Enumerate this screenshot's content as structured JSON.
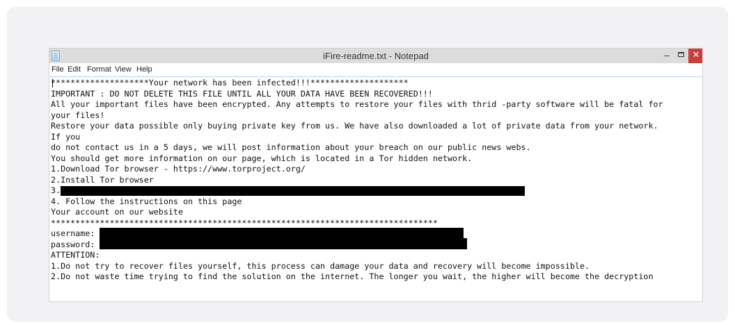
{
  "window": {
    "title": "iFire-readme.txt - Notepad",
    "minimize_glyph": "–",
    "close_glyph": "✕",
    "menu": [
      "File",
      "Edit",
      "Format",
      "View",
      "Help"
    ]
  },
  "document": {
    "lines": [
      "********************Your network has been infected!!!********************",
      "IMPORTANT : DO NOT DELETE THIS FILE UNTIL ALL YOUR DATA HAVE BEEN RECOVERED!!!",
      "All your important files have been encrypted. Any attempts to restore your files with thrid -party software will be fatal for",
      "your files!",
      "Restore your data possible only buying private key from us. We have also downloaded a lot of private data from your network.",
      "If you",
      "do not contact us in a 5 days, we will post information about your breach on our public news webs.",
      "You should get more information on our page, which is located in a Tor hidden network.",
      "1.Download Tor browser - https://www.torproject.org/",
      "2.Install Tor browser",
      "3.",
      "4. Follow the instructions on this page",
      "Your account on our website",
      "*******************************************************************************",
      "username:",
      "password:",
      "ATTENTION:",
      "1.Do not try to recover files yourself, this process can damage your data and recovery will become impossible.",
      "2.Do not waste time trying to find the solution on the internet. The longer you wait, the higher will become the decryption"
    ]
  }
}
